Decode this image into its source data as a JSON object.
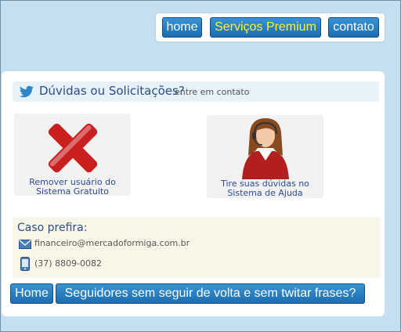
{
  "nav": {
    "home": "home",
    "premium": "Serviços Premium",
    "contact": "contato"
  },
  "header": {
    "title": "Dúvidas ou Solicitações?",
    "subtitle": "entre em contato",
    "icon": "twitter-bird-icon"
  },
  "cards": [
    {
      "label": "Remover usuário do\nSistema Gratuito",
      "icon": "red-x-icon"
    },
    {
      "label": "Tire suas dúvidas no\nSistema de Ajuda",
      "icon": "support-agent-icon"
    }
  ],
  "contact": {
    "title": "Caso prefira:",
    "email": "financeiro@mercadoformiga.com.br",
    "phone": "(37) 8809-0082"
  },
  "bottom": {
    "home": "Home",
    "followers": "Seguidores sem seguir de volta e sem twitar frases?"
  },
  "colors": {
    "page_bg": "#c4dff0",
    "button_blue": "#1c6db0",
    "premium_text": "#fff23a",
    "x_red": "#c91f1f"
  }
}
